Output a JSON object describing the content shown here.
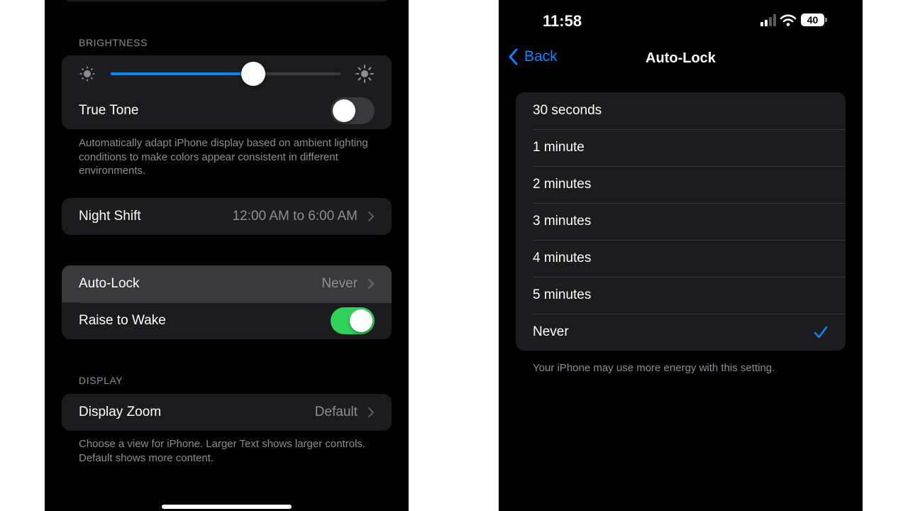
{
  "left": {
    "brightness": {
      "header": "BRIGHTNESS",
      "level": 0.62,
      "true_tone_label": "True Tone",
      "true_tone_on": false,
      "footnote": "Automatically adapt iPhone display based on ambient lighting conditions to make colors appear consistent in different environments."
    },
    "night_shift": {
      "label": "Night Shift",
      "value": "12:00 AM to 6:00 AM"
    },
    "auto_lock": {
      "label": "Auto-Lock",
      "value": "Never"
    },
    "raise_to_wake": {
      "label": "Raise to Wake",
      "on": true
    },
    "display": {
      "header": "DISPLAY",
      "zoom_label": "Display Zoom",
      "zoom_value": "Default",
      "footnote": "Choose a view for iPhone. Larger Text shows larger controls. Default shows more content."
    }
  },
  "right": {
    "status_bar": {
      "time": "11:58",
      "battery": "40"
    },
    "nav": {
      "back_label": "Back",
      "title": "Auto-Lock"
    },
    "options": [
      {
        "label": "30 seconds",
        "selected": false
      },
      {
        "label": "1 minute",
        "selected": false
      },
      {
        "label": "2 minutes",
        "selected": false
      },
      {
        "label": "3 minutes",
        "selected": false
      },
      {
        "label": "4 minutes",
        "selected": false
      },
      {
        "label": "5 minutes",
        "selected": false
      },
      {
        "label": "Never",
        "selected": true
      }
    ],
    "footnote": "Your iPhone may use more energy with this setting."
  },
  "colors": {
    "accent": "#0a84ff",
    "toggle_on": "#30d158",
    "cell_background": "#1c1c1e",
    "secondary_text": "#8d8d93"
  }
}
